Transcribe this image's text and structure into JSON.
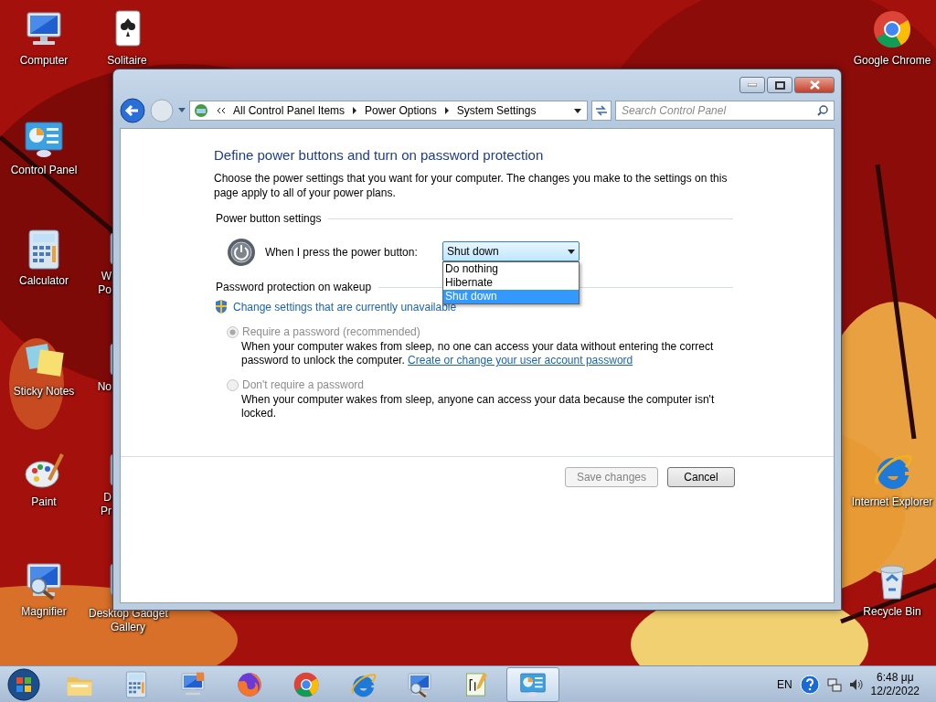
{
  "desktop_icons": [
    {
      "kind": "computer",
      "lines": [
        "Computer"
      ]
    },
    {
      "kind": "solitaire",
      "lines": [
        "Solitaire"
      ]
    },
    {
      "kind": "control-panel",
      "lines": [
        "Control Panel"
      ]
    },
    {
      "kind": "calculator",
      "lines": [
        "Calculator"
      ]
    },
    {
      "kind": "generic",
      "lines": [
        "W",
        "Po"
      ]
    },
    {
      "kind": "sticky-notes",
      "lines": [
        "Sticky Notes"
      ]
    },
    {
      "kind": "generic",
      "lines": [
        "No"
      ]
    },
    {
      "kind": "paint",
      "lines": [
        "Paint"
      ]
    },
    {
      "kind": "generic",
      "lines": [
        "D",
        "Pr"
      ]
    },
    {
      "kind": "magnifier",
      "lines": [
        "Magnifier"
      ]
    },
    {
      "kind": "generic",
      "lines": [
        "Desktop Gadget",
        "Gallery"
      ]
    },
    {
      "kind": "chrome",
      "lines": [
        "Google Chrome"
      ]
    },
    {
      "kind": "ie",
      "lines": [
        "Internet Explorer"
      ]
    },
    {
      "kind": "recycle-bin",
      "lines": [
        "Recycle Bin"
      ]
    }
  ],
  "window": {
    "breadcrumbs": [
      "All Control Panel Items",
      "Power Options",
      "System Settings"
    ],
    "search": {
      "placeholder": "Search Control Panel"
    },
    "title": "Define power buttons and turn on password protection",
    "intro": "Choose the power settings that you want for your computer. The changes you make to the settings on this page apply to all of your power plans.",
    "power_section": {
      "heading": "Power button settings",
      "label": "When I press the power button:",
      "dropdown": {
        "value": "Shut down",
        "expanded": true,
        "options": [
          {
            "label": "Do nothing",
            "selected": false
          },
          {
            "label": "Hibernate",
            "selected": false
          },
          {
            "label": "Shut down",
            "selected": true
          }
        ]
      }
    },
    "password_section": {
      "heading": "Password protection on wakeup",
      "admin_link": "Change settings that are currently unavailable",
      "options": [
        {
          "label": "Require a password (recommended)",
          "selected": true,
          "disabled": true,
          "description": "When your computer wakes from sleep, no one can access your data without entering the correct password to unlock the computer.",
          "link": "Create or change your user account password"
        },
        {
          "label": "Don't require a password",
          "selected": false,
          "disabled": true,
          "description": "When your computer wakes from sleep, anyone can access your data because the computer isn't locked."
        }
      ]
    },
    "buttons": [
      {
        "label": "Save changes",
        "disabled": true
      },
      {
        "label": "Cancel",
        "disabled": false
      }
    ]
  },
  "taskbar": {
    "items": [
      {
        "kind": "explorer",
        "active": false
      },
      {
        "kind": "calculator",
        "active": false
      },
      {
        "kind": "remote",
        "active": false
      },
      {
        "kind": "firefox",
        "active": false
      },
      {
        "kind": "chrome",
        "active": false
      },
      {
        "kind": "ie",
        "active": false
      },
      {
        "kind": "magnifier",
        "active": false
      },
      {
        "kind": "notepad",
        "active": false
      },
      {
        "kind": "control-panel",
        "active": true
      }
    ],
    "language": "EN",
    "time": "6:48 μμ",
    "date": "12/2/2022"
  }
}
